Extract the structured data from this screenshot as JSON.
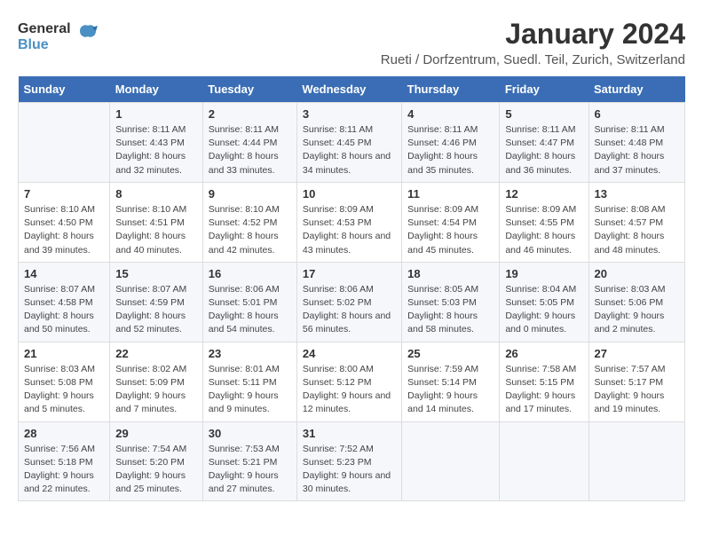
{
  "header": {
    "logo_general": "General",
    "logo_blue": "Blue",
    "title": "January 2024",
    "subtitle": "Rueti / Dorfzentrum, Suedl. Teil, Zurich, Switzerland"
  },
  "weekdays": [
    "Sunday",
    "Monday",
    "Tuesday",
    "Wednesday",
    "Thursday",
    "Friday",
    "Saturday"
  ],
  "weeks": [
    [
      null,
      {
        "day": 1,
        "sunrise": "8:11 AM",
        "sunset": "4:43 PM",
        "daylight": "8 hours and 32 minutes."
      },
      {
        "day": 2,
        "sunrise": "8:11 AM",
        "sunset": "4:44 PM",
        "daylight": "8 hours and 33 minutes."
      },
      {
        "day": 3,
        "sunrise": "8:11 AM",
        "sunset": "4:45 PM",
        "daylight": "8 hours and 34 minutes."
      },
      {
        "day": 4,
        "sunrise": "8:11 AM",
        "sunset": "4:46 PM",
        "daylight": "8 hours and 35 minutes."
      },
      {
        "day": 5,
        "sunrise": "8:11 AM",
        "sunset": "4:47 PM",
        "daylight": "8 hours and 36 minutes."
      },
      {
        "day": 6,
        "sunrise": "8:11 AM",
        "sunset": "4:48 PM",
        "daylight": "8 hours and 37 minutes."
      }
    ],
    [
      {
        "day": 7,
        "sunrise": "8:10 AM",
        "sunset": "4:50 PM",
        "daylight": "8 hours and 39 minutes."
      },
      {
        "day": 8,
        "sunrise": "8:10 AM",
        "sunset": "4:51 PM",
        "daylight": "8 hours and 40 minutes."
      },
      {
        "day": 9,
        "sunrise": "8:10 AM",
        "sunset": "4:52 PM",
        "daylight": "8 hours and 42 minutes."
      },
      {
        "day": 10,
        "sunrise": "8:09 AM",
        "sunset": "4:53 PM",
        "daylight": "8 hours and 43 minutes."
      },
      {
        "day": 11,
        "sunrise": "8:09 AM",
        "sunset": "4:54 PM",
        "daylight": "8 hours and 45 minutes."
      },
      {
        "day": 12,
        "sunrise": "8:09 AM",
        "sunset": "4:55 PM",
        "daylight": "8 hours and 46 minutes."
      },
      {
        "day": 13,
        "sunrise": "8:08 AM",
        "sunset": "4:57 PM",
        "daylight": "8 hours and 48 minutes."
      }
    ],
    [
      {
        "day": 14,
        "sunrise": "8:07 AM",
        "sunset": "4:58 PM",
        "daylight": "8 hours and 50 minutes."
      },
      {
        "day": 15,
        "sunrise": "8:07 AM",
        "sunset": "4:59 PM",
        "daylight": "8 hours and 52 minutes."
      },
      {
        "day": 16,
        "sunrise": "8:06 AM",
        "sunset": "5:01 PM",
        "daylight": "8 hours and 54 minutes."
      },
      {
        "day": 17,
        "sunrise": "8:06 AM",
        "sunset": "5:02 PM",
        "daylight": "8 hours and 56 minutes."
      },
      {
        "day": 18,
        "sunrise": "8:05 AM",
        "sunset": "5:03 PM",
        "daylight": "8 hours and 58 minutes."
      },
      {
        "day": 19,
        "sunrise": "8:04 AM",
        "sunset": "5:05 PM",
        "daylight": "9 hours and 0 minutes."
      },
      {
        "day": 20,
        "sunrise": "8:03 AM",
        "sunset": "5:06 PM",
        "daylight": "9 hours and 2 minutes."
      }
    ],
    [
      {
        "day": 21,
        "sunrise": "8:03 AM",
        "sunset": "5:08 PM",
        "daylight": "9 hours and 5 minutes."
      },
      {
        "day": 22,
        "sunrise": "8:02 AM",
        "sunset": "5:09 PM",
        "daylight": "9 hours and 7 minutes."
      },
      {
        "day": 23,
        "sunrise": "8:01 AM",
        "sunset": "5:11 PM",
        "daylight": "9 hours and 9 minutes."
      },
      {
        "day": 24,
        "sunrise": "8:00 AM",
        "sunset": "5:12 PM",
        "daylight": "9 hours and 12 minutes."
      },
      {
        "day": 25,
        "sunrise": "7:59 AM",
        "sunset": "5:14 PM",
        "daylight": "9 hours and 14 minutes."
      },
      {
        "day": 26,
        "sunrise": "7:58 AM",
        "sunset": "5:15 PM",
        "daylight": "9 hours and 17 minutes."
      },
      {
        "day": 27,
        "sunrise": "7:57 AM",
        "sunset": "5:17 PM",
        "daylight": "9 hours and 19 minutes."
      }
    ],
    [
      {
        "day": 28,
        "sunrise": "7:56 AM",
        "sunset": "5:18 PM",
        "daylight": "9 hours and 22 minutes."
      },
      {
        "day": 29,
        "sunrise": "7:54 AM",
        "sunset": "5:20 PM",
        "daylight": "9 hours and 25 minutes."
      },
      {
        "day": 30,
        "sunrise": "7:53 AM",
        "sunset": "5:21 PM",
        "daylight": "9 hours and 27 minutes."
      },
      {
        "day": 31,
        "sunrise": "7:52 AM",
        "sunset": "5:23 PM",
        "daylight": "9 hours and 30 minutes."
      },
      null,
      null,
      null
    ]
  ]
}
